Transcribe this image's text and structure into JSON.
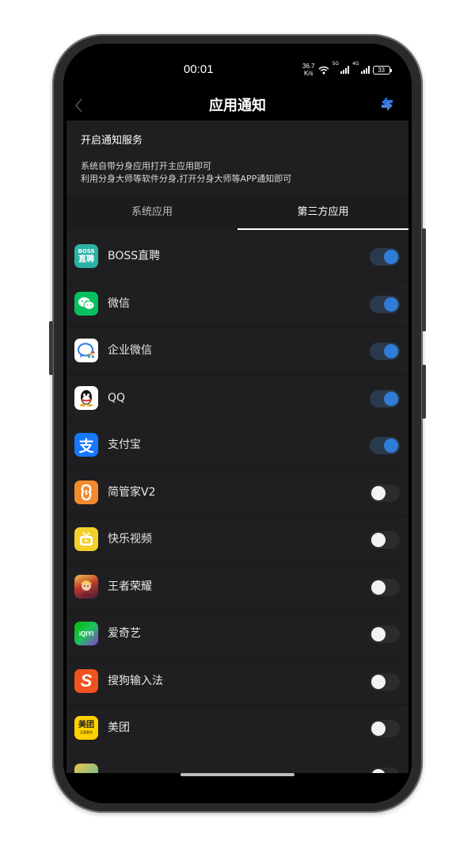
{
  "status_bar": {
    "time": "00:01",
    "net_speed_value": "36.7",
    "net_speed_unit": "K/s",
    "signal_1_tag": "5G",
    "signal_2_tag": "4G",
    "battery": "33"
  },
  "header": {
    "title": "应用通知",
    "back_icon": "chevron-left-icon",
    "refresh_icon": "sync-icon"
  },
  "service": {
    "title": "开启通知服务",
    "desc_line1": "系统自带分身应用打开主应用即可",
    "desc_line2": "利用分身大师等软件分身,打开分身大师等APP通知即可"
  },
  "tabs": [
    {
      "label": "系统应用",
      "active": false
    },
    {
      "label": "第三方应用",
      "active": true
    }
  ],
  "apps": [
    {
      "name": "BOSS直聘",
      "enabled": true,
      "icon": "boss-zhipin-icon",
      "icon_top": "BOSS",
      "icon_bottom": "直聘",
      "color": "#2bb3a6"
    },
    {
      "name": "微信",
      "enabled": true,
      "icon": "wechat-icon",
      "color": "#07c160"
    },
    {
      "name": "企业微信",
      "enabled": true,
      "icon": "wecom-icon",
      "color": "#ffffff"
    },
    {
      "name": "QQ",
      "enabled": true,
      "icon": "qq-icon",
      "color": "#ffffff"
    },
    {
      "name": "支付宝",
      "enabled": true,
      "icon": "alipay-icon",
      "icon_text": "支",
      "color": "#1677ff"
    },
    {
      "name": "简管家V2",
      "enabled": false,
      "icon": "jianguanjia-icon",
      "color": "#f28a2e"
    },
    {
      "name": "快乐视频",
      "enabled": false,
      "icon": "happy-video-icon",
      "color": "#f3d12a"
    },
    {
      "name": "王者荣耀",
      "enabled": false,
      "icon": "honor-of-kings-icon",
      "color": "#b0412a"
    },
    {
      "name": "爱奇艺",
      "enabled": false,
      "icon": "iqiyi-icon",
      "icon_text": "iQIYI",
      "color": "#00be06"
    },
    {
      "name": "搜狗输入法",
      "enabled": false,
      "icon": "sogou-input-icon",
      "icon_text": "S",
      "color": "#f0531f"
    },
    {
      "name": "美团",
      "enabled": false,
      "icon": "meituan-icon",
      "icon_text": "美团",
      "icon_sub": "买菜都快",
      "color": "#ffd100"
    }
  ],
  "colors": {
    "toggle_on": "#2f7dd7",
    "toggle_off_knob": "#f2f2f2",
    "background": "#1f1f21"
  }
}
